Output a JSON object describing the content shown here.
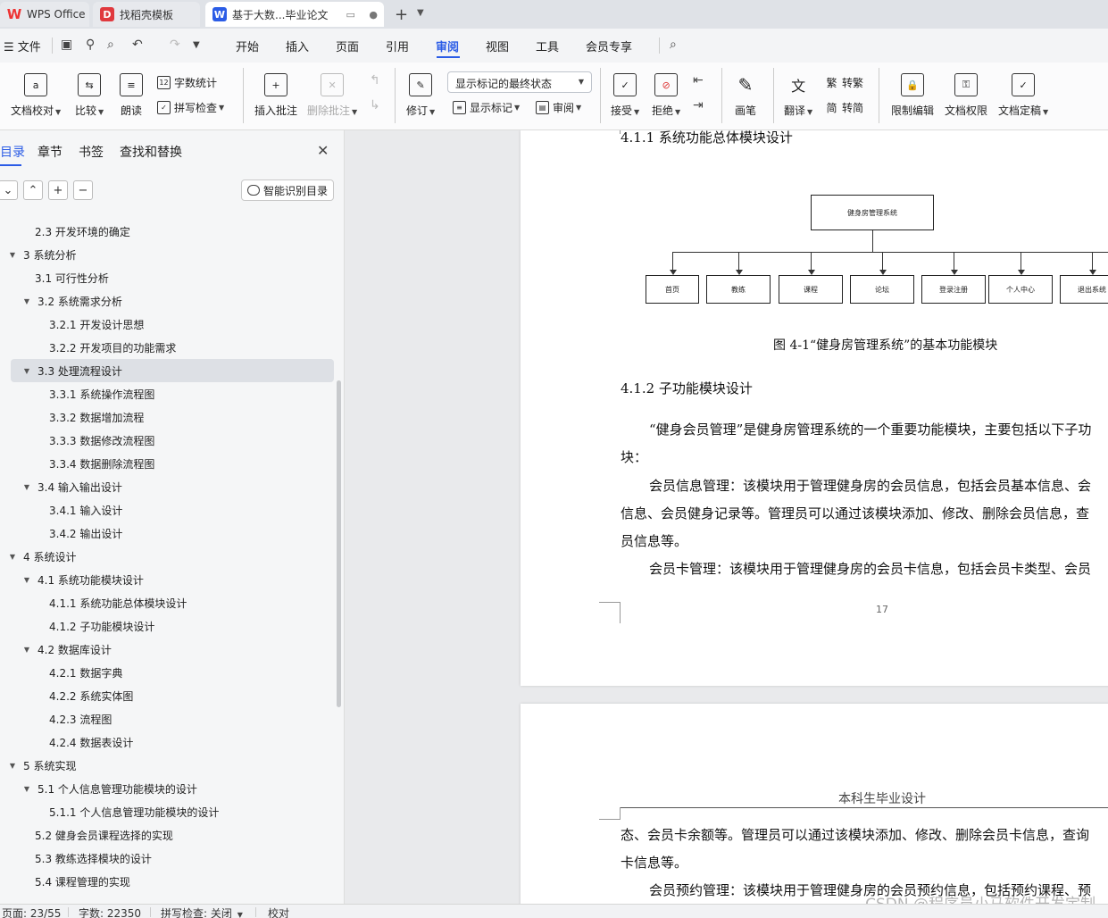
{
  "tabs": {
    "wps": "WPS Office",
    "template": "找稻壳模板",
    "doc": "基于大数...毕业论文",
    "doc_extra": "▭ ●",
    "new_tab": "+"
  },
  "menu": {
    "file": "文件",
    "items": [
      "开始",
      "插入",
      "页面",
      "引用",
      "审阅",
      "视图",
      "工具",
      "会员专享"
    ]
  },
  "ribbon": {
    "proofread": "文档校对",
    "compare": "比较",
    "read_aloud": "朗读",
    "word_count": "字数统计",
    "spell_check": "拼写检查",
    "insert_comment": "插入批注",
    "delete_comment": "删除批注",
    "revise": "修订",
    "markup_state": "显示标记的最终状态",
    "show_markup": "显示标记",
    "review": "审阅",
    "accept": "接受",
    "reject": "拒绝",
    "draw": "画笔",
    "translate": "翻译",
    "to_traditional": "转繁",
    "to_simplified": "转简",
    "restrict_edit": "限制编辑",
    "doc_permission": "文档权限",
    "finalize": "文档定稿"
  },
  "nav": {
    "tabs": [
      "目录",
      "章节",
      "书签",
      "查找和替换"
    ],
    "close": "✕",
    "smart_toc": "智能识别目录",
    "toc": [
      {
        "label": "2.3 开发环境的确定",
        "level": 2,
        "arrow": ""
      },
      {
        "label": "3  系统分析",
        "level": 1,
        "arrow": "▼"
      },
      {
        "label": "3.1 可行性分析",
        "level": 2,
        "arrow": ""
      },
      {
        "label": "3.2  系统需求分析",
        "level": 2,
        "arrow": "▼"
      },
      {
        "label": "3.2.1  开发设计思想",
        "level": 3,
        "arrow": ""
      },
      {
        "label": "3.2.2  开发项目的功能需求",
        "level": 3,
        "arrow": ""
      },
      {
        "label": "3.3 处理流程设计",
        "level": 2,
        "arrow": "▼"
      },
      {
        "label": "3.3.1 系统操作流程图",
        "level": 3,
        "arrow": ""
      },
      {
        "label": "3.3.2 数据增加流程",
        "level": 3,
        "arrow": ""
      },
      {
        "label": "3.3.3 数据修改流程图",
        "level": 3,
        "arrow": ""
      },
      {
        "label": "3.3.4 数据删除流程图",
        "level": 3,
        "arrow": ""
      },
      {
        "label": "3.4 输入输出设计",
        "level": 2,
        "arrow": "▼"
      },
      {
        "label": "3.4.1 输入设计",
        "level": 3,
        "arrow": ""
      },
      {
        "label": "3.4.2 输出设计",
        "level": 3,
        "arrow": ""
      },
      {
        "label": "4  系统设计",
        "level": 1,
        "arrow": "▼"
      },
      {
        "label": "4.1 系统功能模块设计",
        "level": 2,
        "arrow": "▼"
      },
      {
        "label": "4.1.1 系统功能总体模块设计",
        "level": 3,
        "arrow": ""
      },
      {
        "label": "4.1.2 子功能模块设计",
        "level": 3,
        "arrow": ""
      },
      {
        "label": "4.2 数据库设计",
        "level": 2,
        "arrow": "▼"
      },
      {
        "label": "4.2.1 数据字典",
        "level": 3,
        "arrow": ""
      },
      {
        "label": "4.2.2 系统实体图",
        "level": 3,
        "arrow": ""
      },
      {
        "label": "4.2.3 流程图",
        "level": 3,
        "arrow": ""
      },
      {
        "label": "4.2.4 数据表设计",
        "level": 3,
        "arrow": ""
      },
      {
        "label": "5  系统实现",
        "level": 1,
        "arrow": "▼"
      },
      {
        "label": "5.1 个人信息管理功能模块的设计",
        "level": 2,
        "arrow": "▼"
      },
      {
        "label": "5.1.1 个人信息管理功能模块的设计",
        "level": 3,
        "arrow": ""
      },
      {
        "label": "5.2 健身会员课程选择的实现",
        "level": 2,
        "arrow": ""
      },
      {
        "label": "5.3 教练选择模块的设计",
        "level": 2,
        "arrow": ""
      },
      {
        "label": "5.4 课程管理的实现",
        "level": 2,
        "arrow": ""
      }
    ],
    "selected_index": 6
  },
  "document": {
    "h411": "4.1.1 系统功能总体模块设计",
    "diagram_root": "健身房管理系统",
    "diagram_children": [
      "首页",
      "教练",
      "课程",
      "论坛",
      "登录注册",
      "个人中心",
      "退出系统"
    ],
    "figure_caption": "图 4-1“健身房管理系统”的基本功能模块",
    "h412": "4.1.2 子功能模块设计",
    "p1_line1": "“健身会员管理”是健身房管理系统的一个重要功能模块，主要包括以下子功",
    "p1_line2": "块：",
    "p2_line1": "会员信息管理：该模块用于管理健身房的会员信息，包括会员基本信息、会",
    "p2_line2": "信息、会员健身记录等。管理员可以通过该模块添加、修改、删除会员信息，查",
    "p2_line3": "员信息等。",
    "p3_line1": "会员卡管理：该模块用于管理健身房的会员卡信息，包括会员卡类型、会员",
    "page_number": "17",
    "page2_header": "本科生毕业设计",
    "p4_line1": "态、会员卡余额等。管理员可以通过该模块添加、修改、删除会员卡信息，查询",
    "p4_line2": "卡信息等。",
    "p5_line1": "会员预约管理：该模块用于管理健身房的会员预约信息，包括预约课程、预"
  },
  "status": {
    "page": "页面: 23/55",
    "words": "字数: 22350",
    "spell": "拼写检查: 关闭",
    "proof": "校对"
  },
  "watermark": "CSDN @程序员小马软件开发定制"
}
